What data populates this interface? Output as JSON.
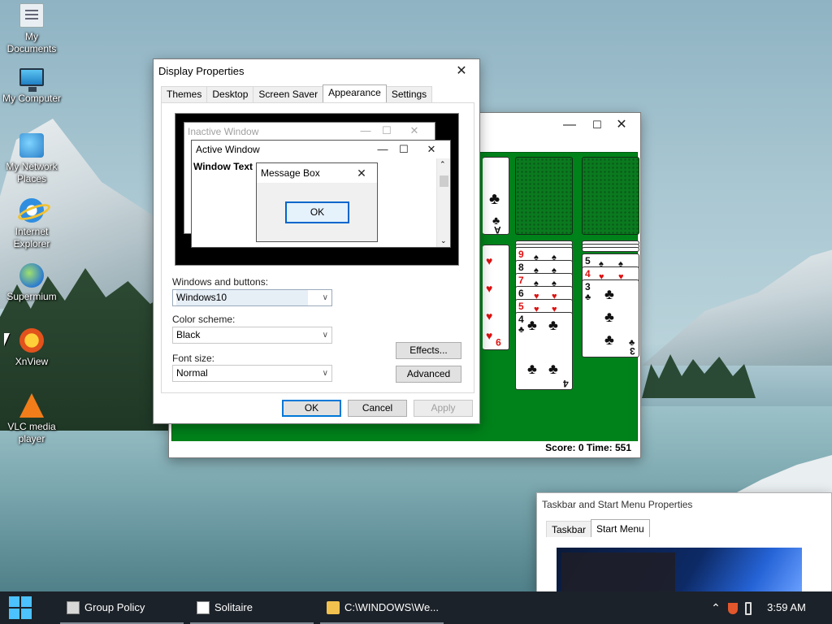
{
  "desktop": {
    "icons": [
      {
        "label": "My Documents",
        "icon": "my-documents-icon"
      },
      {
        "label": "My Computer",
        "icon": "my-computer-icon"
      },
      {
        "label": "My Network Places",
        "icon": "network-places-icon"
      },
      {
        "label": "Internet Explorer",
        "icon": "internet-explorer-icon"
      },
      {
        "label": "Supermium",
        "icon": "supermium-icon"
      },
      {
        "label": "XnView",
        "icon": "xnview-icon"
      },
      {
        "label": "VLC media player",
        "icon": "vlc-icon"
      }
    ]
  },
  "solitaire": {
    "status": "Score: 0 Time: 551",
    "cards": {
      "foundation_rank": "A",
      "col5": [
        "9",
        "8",
        "7",
        "6",
        "5",
        "4"
      ],
      "col6": [
        "5",
        "4",
        "3"
      ],
      "col6_bottom": "3",
      "col5_bottom": "4",
      "col4_bottom": "9"
    }
  },
  "display_properties": {
    "title": "Display Properties",
    "tabs": [
      "Themes",
      "Desktop",
      "Screen Saver",
      "Appearance",
      "Settings"
    ],
    "active_tab": "Appearance",
    "preview": {
      "inactive_title": "Inactive Window",
      "active_title": "Active Window",
      "window_text": "Window Text",
      "message_box_title": "Message Box",
      "ok": "OK"
    },
    "windows_and_buttons_label": "Windows and buttons:",
    "windows_and_buttons_value": "Windows10",
    "color_scheme_label": "Color scheme:",
    "color_scheme_value": "Black",
    "font_size_label": "Font size:",
    "font_size_value": "Normal",
    "effects_button": "Effects...",
    "advanced_button": "Advanced",
    "ok_button": "OK",
    "cancel_button": "Cancel",
    "apply_button": "Apply"
  },
  "taskbar_props": {
    "title": "Taskbar and Start Menu Properties",
    "tabs": [
      "Taskbar",
      "Start Menu"
    ],
    "active_tab": "Start Menu"
  },
  "taskbar": {
    "items": [
      {
        "label": "Group Policy"
      },
      {
        "label": "Solitaire"
      },
      {
        "label": "C:\\WINDOWS\\We..."
      }
    ],
    "clock": "3:59 AM"
  },
  "colors": {
    "felt": "#00821a",
    "accent": "#0078d7",
    "taskbar": "#1c2229"
  }
}
